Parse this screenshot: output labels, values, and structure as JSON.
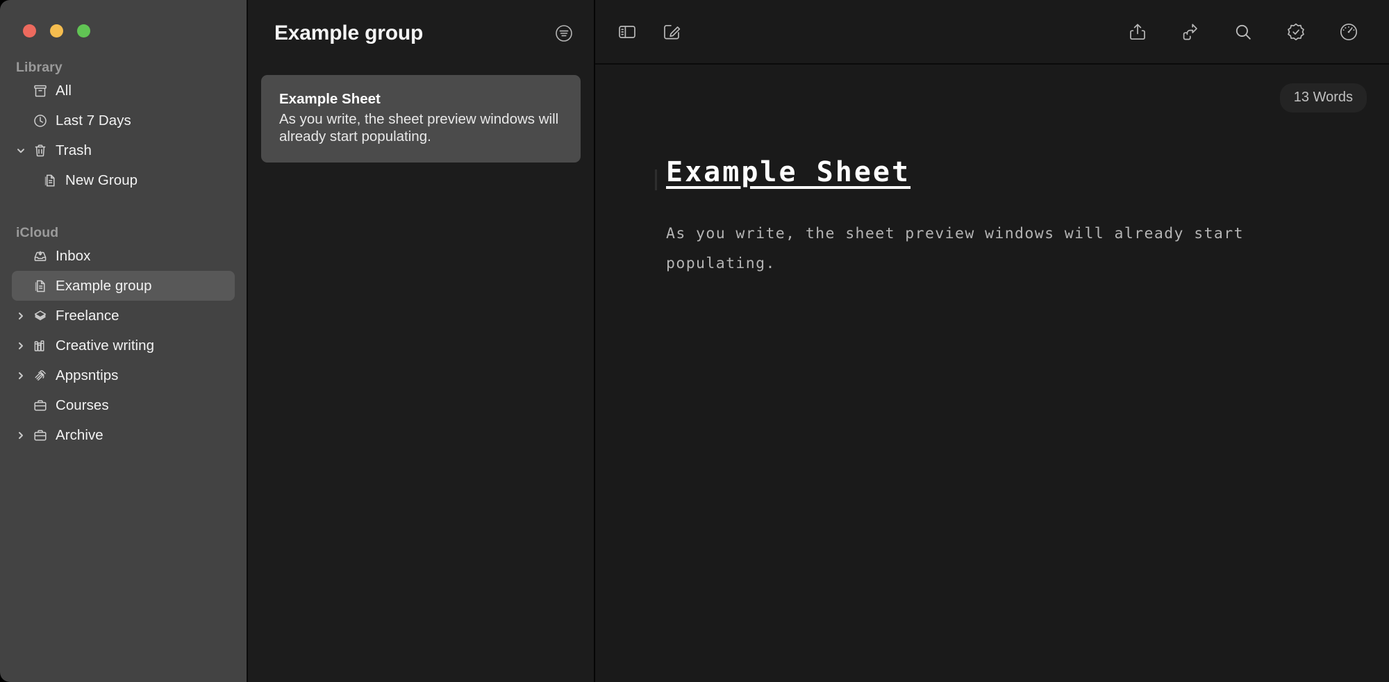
{
  "window": {
    "traffic_lights": [
      {
        "name": "close",
        "color": "#ED6A5E"
      },
      {
        "name": "minimize",
        "color": "#F5BD4F"
      },
      {
        "name": "zoom",
        "color": "#61C454"
      }
    ]
  },
  "sidebar": {
    "sections": [
      {
        "label": "Library",
        "items": [
          {
            "label": "All",
            "icon": "archive-box-icon",
            "disclosure": "none",
            "indent": false,
            "selected": false
          },
          {
            "label": "Last 7 Days",
            "icon": "clock-icon",
            "disclosure": "none",
            "indent": false,
            "selected": false
          },
          {
            "label": "Trash",
            "icon": "trash-icon",
            "disclosure": "expanded",
            "indent": false,
            "selected": false
          },
          {
            "label": "New Group",
            "icon": "document-icon",
            "disclosure": "none",
            "indent": true,
            "selected": false
          }
        ]
      },
      {
        "label": "iCloud",
        "items": [
          {
            "label": "Inbox",
            "icon": "inbox-icon",
            "disclosure": "none",
            "indent": false,
            "selected": false
          },
          {
            "label": "Example group",
            "icon": "document-icon",
            "disclosure": "none",
            "indent": false,
            "selected": true
          },
          {
            "label": "Freelance",
            "icon": "layers-icon",
            "disclosure": "collapsed",
            "indent": false,
            "selected": false
          },
          {
            "label": "Creative writing",
            "icon": "books-icon",
            "disclosure": "collapsed",
            "indent": false,
            "selected": false
          },
          {
            "label": "Appsntips",
            "icon": "ribbon-icon",
            "disclosure": "collapsed",
            "indent": false,
            "selected": false
          },
          {
            "label": "Courses",
            "icon": "briefcase-icon",
            "disclosure": "none",
            "indent": false,
            "selected": false
          },
          {
            "label": "Archive",
            "icon": "briefcase-icon",
            "disclosure": "collapsed",
            "indent": false,
            "selected": false
          }
        ]
      }
    ]
  },
  "sheet_list": {
    "group_title": "Example group",
    "sort_icon": "sort-filter-icon",
    "sheets": [
      {
        "title": "Example Sheet",
        "preview": "As you write, the sheet preview windows will already start populating.",
        "selected": true
      }
    ]
  },
  "editor": {
    "toolbar_left": [
      {
        "name": "toggle-sidebar-icon",
        "label": "Toggle Sidebar"
      },
      {
        "name": "new-sheet-icon",
        "label": "New Sheet"
      }
    ],
    "toolbar_right": [
      {
        "name": "share-icon",
        "label": "Share"
      },
      {
        "name": "publish-icon",
        "label": "Publish"
      },
      {
        "name": "search-icon",
        "label": "Search"
      },
      {
        "name": "checkmark-seal-icon",
        "label": "Editing Assistant"
      },
      {
        "name": "gauge-icon",
        "label": "Statistics"
      }
    ],
    "word_count": "13 Words",
    "document": {
      "heading": "Example Sheet",
      "paragraph": "As you write, the sheet preview windows will already start populating."
    }
  }
}
